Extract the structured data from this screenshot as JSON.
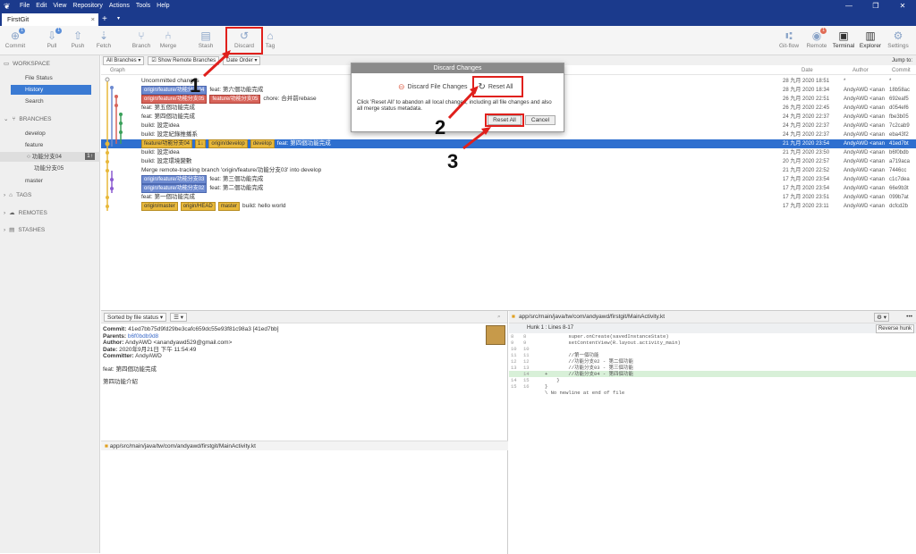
{
  "app": {
    "tab_title": "FirstGit",
    "tab_close": "×",
    "tab_add": "+",
    "tab_dropdown": "▾",
    "logo_glyph": "❦",
    "window_controls": [
      "—",
      "❐",
      "✕"
    ]
  },
  "menu": [
    "File",
    "Edit",
    "View",
    "Repository",
    "Actions",
    "Tools",
    "Help"
  ],
  "toolbar": {
    "commit": "Commit",
    "commit_badge": "1",
    "pull": "Pull",
    "pull_badge": "1",
    "push": "Push",
    "fetch": "Fetch",
    "branch": "Branch",
    "merge": "Merge",
    "stash": "Stash",
    "discard": "Discard",
    "tag": "Tag",
    "gitflow": "Git-flow",
    "remote": "Remote",
    "remote_badge": "1",
    "terminal": "Terminal",
    "explorer": "Explorer",
    "settings": "Settings"
  },
  "sidebar": {
    "workspace": "WORKSPACE",
    "file_status": "File Status",
    "history": "History",
    "search": "Search",
    "branches": "BRANCHES",
    "develop": "develop",
    "feature": "feature",
    "branch_sel": "功能分支04",
    "branch_sel_badge": "1↑",
    "branch_05": "功能分支05",
    "master": "master",
    "tags": "TAGS",
    "remotes": "REMOTES",
    "stashes": "STASHES"
  },
  "filter": {
    "all_branches": "All Branches ▾",
    "show_remote": "Show Remote Branches",
    "date_order": "Date Order ▾",
    "jump_to": "Jump to:"
  },
  "columns": {
    "graph": "Graph",
    "date": "Date",
    "author": "Author",
    "commit": "Commit"
  },
  "rows": [
    {
      "tags": [],
      "text": "Uncommitted changes",
      "date": "28 九月 2020 18:51",
      "author": "*",
      "hash": "*"
    },
    {
      "tags": [
        {
          "t": "origin/feature/功能分支04",
          "c": "b"
        }
      ],
      "text": "feat: 第六個功能完成",
      "date": "28 九月 2020 18:34",
      "author": "AndyAWD <anan",
      "hash": "18b58ac"
    },
    {
      "tags": [
        {
          "t": "origin/feature/功能分支05",
          "c": "r"
        },
        {
          "t": "feature/功能分支05",
          "c": "r"
        }
      ],
      "text": "chore: 合并前rebase",
      "date": "26 九月 2020 22:51",
      "author": "AndyAWD <anan",
      "hash": "692eaf5"
    },
    {
      "tags": [],
      "text": "feat: 第五個功能完成",
      "date": "26 九月 2020 22:45",
      "author": "AndyAWD <anan",
      "hash": "d054ef6"
    },
    {
      "tags": [],
      "text": "feat: 第四個功能完成",
      "date": "24 九月 2020 22:37",
      "author": "AndyAWD <anan",
      "hash": "fbe3b05"
    },
    {
      "tags": [],
      "text": "build: 設定idea",
      "date": "24 九月 2020 22:37",
      "author": "AndyAWD <anan",
      "hash": "7c2cab9"
    },
    {
      "tags": [],
      "text": "build: 設定紀錄推播系",
      "date": "24 九月 2020 22:37",
      "author": "AndyAWD <anan",
      "hash": "eba43f2"
    },
    {
      "tags": [
        {
          "t": "feature/功能分支04",
          "c": "o"
        },
        {
          "t": "1↓",
          "c": "o"
        },
        {
          "t": "origin/develop",
          "c": "o"
        },
        {
          "t": "develop",
          "c": "o"
        }
      ],
      "text": "feat: 第四個功能完成",
      "date": "21 九月 2020 23:54",
      "author": "AndyAWD <anan",
      "hash": "41ed7bt"
    },
    {
      "tags": [],
      "text": "build: 設定idea",
      "date": "21 九月 2020 23:50",
      "author": "AndyAWD <anan",
      "hash": "b6f0bdb"
    },
    {
      "tags": [],
      "text": "build: 設定環境變數",
      "date": "20 九月 2020 22:57",
      "author": "AndyAWD <anan",
      "hash": "a719aca"
    },
    {
      "tags": [],
      "text": "Merge remote-tracking branch 'origin/feature/功能分支03' into develop",
      "date": "21 九月 2020 22:52",
      "author": "AndyAWD <anan",
      "hash": "7446cc"
    },
    {
      "tags": [
        {
          "t": "origin/feature/功能分支03",
          "c": "b"
        }
      ],
      "text": "feat: 第三個功能完成",
      "date": "17 九月 2020 23:54",
      "author": "AndyAWD <anan",
      "hash": "c1c7dea"
    },
    {
      "tags": [
        {
          "t": "origin/feature/功能分支02",
          "c": "b"
        }
      ],
      "text": "feat: 第二個功能完成",
      "date": "17 九月 2020 23:54",
      "author": "AndyAWD <anan",
      "hash": "66e9b3t"
    },
    {
      "tags": [],
      "text": "feat: 第一個功能完成",
      "date": "17 九月 2020 23:51",
      "author": "AndyAWD <anan",
      "hash": "099b7at"
    },
    {
      "tags": [
        {
          "t": "origin/master",
          "c": "o"
        },
        {
          "t": "origin/HEAD",
          "c": "o"
        },
        {
          "t": "master",
          "c": "o"
        }
      ],
      "text": "build: hello world",
      "date": "17 九月 2020 23:11",
      "author": "AndyAWD <anan",
      "hash": "dcfcd2b"
    }
  ],
  "bottom": {
    "sort": "Sorted by file status ▾",
    "list_btn": "☰ ▾",
    "commit_label": "Commit:",
    "commit_val": "41ed7bb75d9fd29be3cafc659dc55e93f81c98a3 [41ed7bb]",
    "parents_label": "Parents:",
    "parents_val": "b6f0bdb9d8",
    "author_label": "Author:",
    "author_val": "AndyAWD <anandyawd529@gmail.com>",
    "date_label": "Date:",
    "date_val": "2020年9月21日 下午 11:54:49",
    "committer_label": "Committer:",
    "committer_val": "AndyAWD",
    "msg1": "feat: 第四個功能完成",
    "msg2": "第四功能介紹",
    "file_path": "app/src/main/java/tw/com/andyawd/firstgit/MainActivity.kt",
    "hunk": "Hunk 1 : Lines 8-17",
    "reverse": "Reverse hunk",
    "more": "•••"
  },
  "diff": [
    {
      "a": "8",
      "b": "8",
      "code": "        super.onCreate(savedInstanceState)",
      "add": false
    },
    {
      "a": "9",
      "b": "9",
      "code": "        setContentView(R.layout.activity_main)",
      "add": false
    },
    {
      "a": "10",
      "b": "10",
      "code": "",
      "add": false
    },
    {
      "a": "11",
      "b": "11",
      "code": "        //第一個功能",
      "add": false
    },
    {
      "a": "12",
      "b": "12",
      "code": "        //功能分支02 - 第二個功能",
      "add": false
    },
    {
      "a": "13",
      "b": "13",
      "code": "        //功能分支03 - 第三個功能",
      "add": false
    },
    {
      "a": "",
      "b": "14",
      "code": "+       //功能分支04 - 第四個功能",
      "add": true
    },
    {
      "a": "14",
      "b": "15",
      "code": "    }",
      "add": false
    },
    {
      "a": "15",
      "b": "16",
      "code": "}",
      "add": false
    },
    {
      "a": "",
      "b": "",
      "code": "\\ No newline at end of file",
      "add": false
    }
  ],
  "dialog": {
    "title": "Discard Changes",
    "tab1": "Discard File Changes",
    "tab2": "Reset All",
    "message": "Click 'Reset All' to abandon all local changes, including all file changes and also all merge status metadata.",
    "reset": "Reset All",
    "cancel": "Cancel"
  },
  "annotations": {
    "a1": "1",
    "a2": "2",
    "a3": "3"
  },
  "colors": {
    "titlebar": "#1b3a8c",
    "selection": "#2e6fcf",
    "highlight": "#e0201c"
  }
}
